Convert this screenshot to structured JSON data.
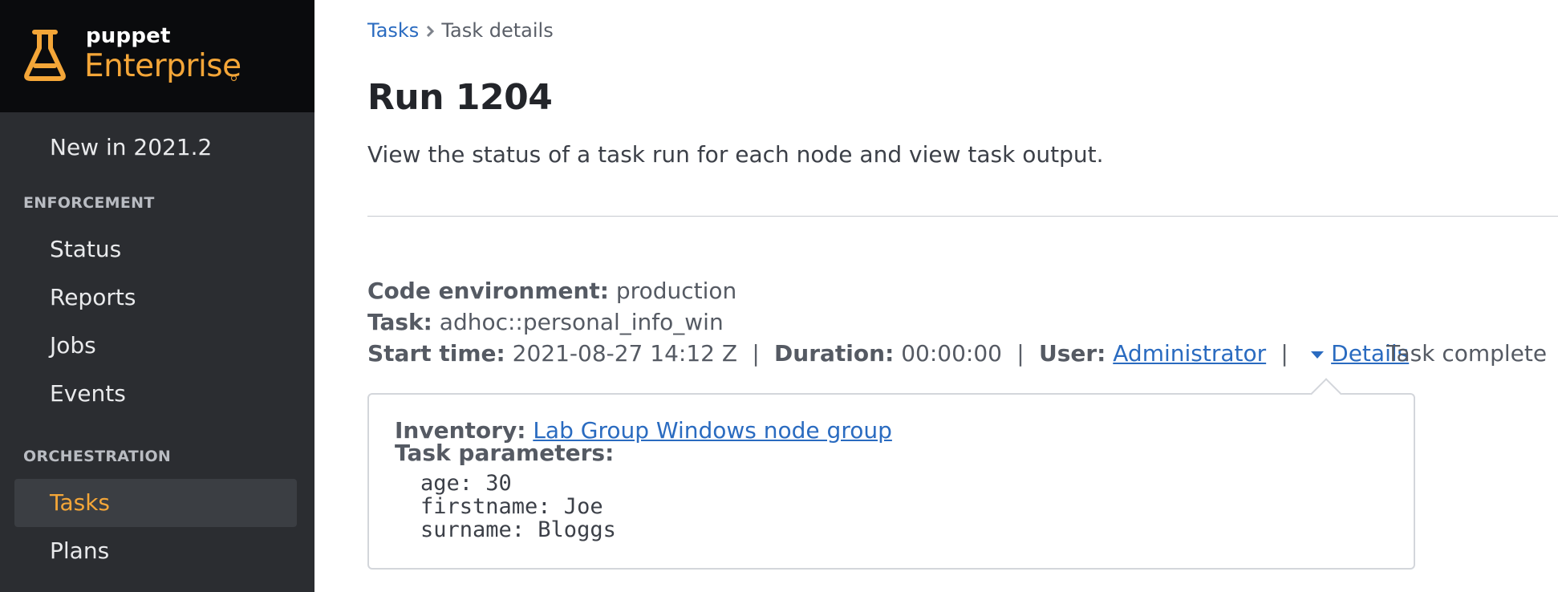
{
  "brand": {
    "top": "puppet",
    "main": "Enterprise",
    "accent_color": "#f4a638"
  },
  "sidebar": {
    "items": [
      {
        "label": "New in 2021.2"
      },
      {
        "section": "ENFORCEMENT"
      },
      {
        "label": "Status"
      },
      {
        "label": "Reports"
      },
      {
        "label": "Jobs"
      },
      {
        "label": "Events"
      },
      {
        "section": "ORCHESTRATION"
      },
      {
        "label": "Tasks",
        "active": true
      },
      {
        "label": "Plans"
      }
    ]
  },
  "breadcrumb": {
    "parent": "Tasks",
    "separator_icon": "chevron-right-icon",
    "current": "Task details"
  },
  "page": {
    "title": "Run 1204",
    "subtitle": "View the status of a task run for each node and view task output."
  },
  "meta": {
    "code_env_label": "Code environment:",
    "code_env": "production",
    "task_label": "Task:",
    "task": "adhoc::personal_info_win",
    "start_label": "Start time:",
    "start": "2021-08-27 14:12 Z",
    "duration_label": "Duration:",
    "duration": "00:00:00",
    "user_label": "User:",
    "user": "Administrator",
    "details_label": "Details",
    "status": "Task complete"
  },
  "details": {
    "inventory_label": "Inventory:",
    "inventory": "Lab Group Windows node group",
    "params_label": "Task parameters:",
    "params": [
      "age: 30",
      "firstname: Joe",
      "surname: Bloggs"
    ]
  },
  "colors": {
    "link": "#2a6bc0",
    "sidebar_bg": "#2b2d31",
    "brand_bg": "#0a0b0d"
  }
}
